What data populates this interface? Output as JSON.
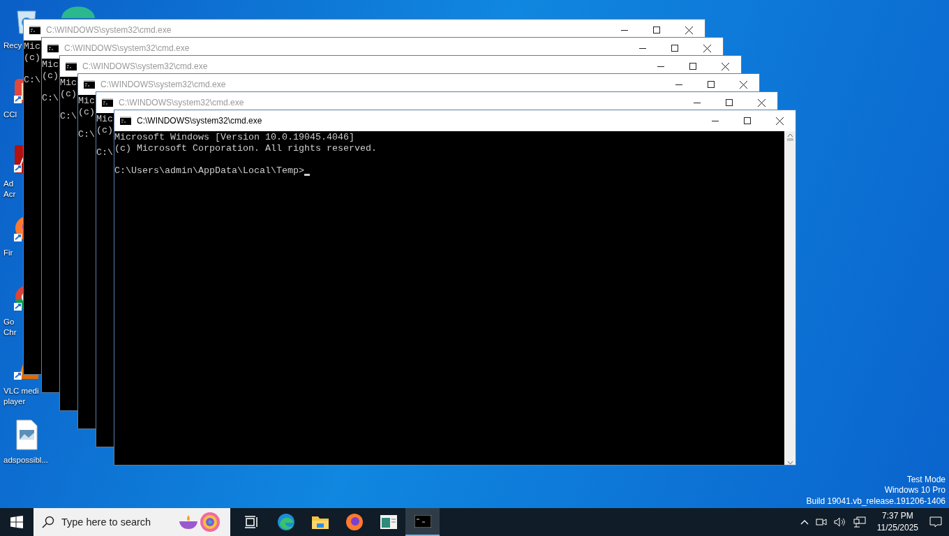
{
  "desktop_icons": [
    {
      "kind": "recycle",
      "lines": [
        "Recy"
      ]
    },
    {
      "kind": "ccleaner",
      "lines": [
        "CCl"
      ]
    },
    {
      "kind": "acrobat",
      "lines": [
        "Ad",
        "Acr"
      ]
    },
    {
      "kind": "firefox",
      "lines": [
        "Fir"
      ]
    },
    {
      "kind": "chrome",
      "lines": [
        "Go",
        "Chr"
      ]
    },
    {
      "kind": "vlc",
      "lines": [
        "VLC medi",
        "player"
      ]
    },
    {
      "kind": "image",
      "lines": [
        "adspossibl..."
      ]
    }
  ],
  "windows": [
    {
      "title": "C:\\WINDOWS\\system32\\cmd.exe",
      "active": false,
      "banner": [
        "Mic",
        "(c)"
      ],
      "prompt": "C:\\"
    },
    {
      "title": "C:\\WINDOWS\\system32\\cmd.exe",
      "active": false,
      "banner": [
        "Mic",
        "(c)"
      ],
      "prompt": "C:\\"
    },
    {
      "title": "C:\\WINDOWS\\system32\\cmd.exe",
      "active": false,
      "banner": [
        "Mic",
        "(c)"
      ],
      "prompt": "C:\\"
    },
    {
      "title": "C:\\WINDOWS\\system32\\cmd.exe",
      "active": false,
      "banner": [
        "Mic",
        "(c)"
      ],
      "prompt": "C:\\"
    },
    {
      "title": "C:\\WINDOWS\\system32\\cmd.exe",
      "active": false,
      "banner": [
        "Mic",
        "(c)"
      ],
      "prompt": "C:\\"
    },
    {
      "title": "C:\\WINDOWS\\system32\\cmd.exe",
      "active": true,
      "banner": [
        "Microsoft Windows [Version 10.0.19045.4046]",
        "(c) Microsoft Corporation. All rights reserved."
      ],
      "prompt": "C:\\Users\\admin\\AppData\\Local\\Temp>"
    }
  ],
  "system_info": [
    "Test Mode",
    "Windows 10 Pro",
    "Build 19041.vb_release.191206-1406"
  ],
  "taskbar": {
    "search": {
      "placeholder": "Type here to search"
    },
    "apps": [
      {
        "kind": "taskview",
        "selected": false
      },
      {
        "kind": "edge",
        "selected": false
      },
      {
        "kind": "explorer",
        "selected": false
      },
      {
        "kind": "firefox",
        "selected": false
      },
      {
        "kind": "app",
        "selected": false
      },
      {
        "kind": "cmd",
        "selected": true
      }
    ],
    "time": "7:37 PM",
    "date": "11/25/2025"
  }
}
